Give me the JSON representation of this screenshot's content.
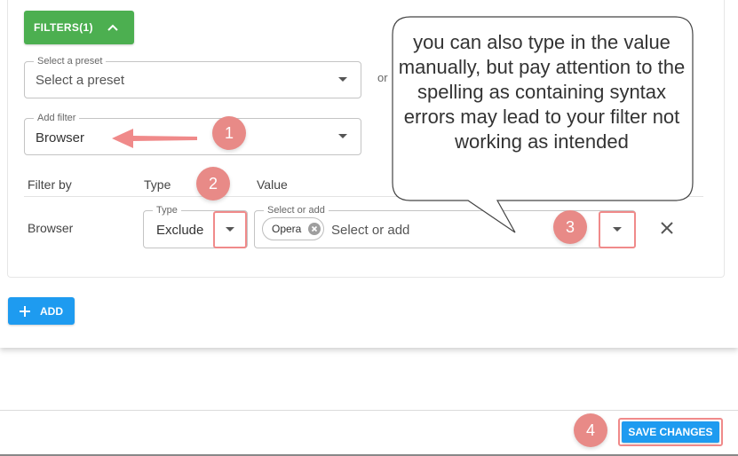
{
  "filters_button": {
    "label": "FILTERS(1)"
  },
  "preset": {
    "legend": "Select a preset",
    "value": "Select a preset"
  },
  "or_label": "or",
  "add_filter": {
    "legend": "Add filter",
    "value": "Browser"
  },
  "table": {
    "headers": [
      "Filter by",
      "Type",
      "Value"
    ],
    "row": {
      "filter_by": "Browser",
      "type_legend": "Type",
      "type_value": "Exclude",
      "value_legend": "Select or add",
      "value_placeholder": "Select or add",
      "chips": [
        "Opera"
      ]
    }
  },
  "add_button": {
    "label": "ADD"
  },
  "save_button": {
    "label": "SAVE CHANGES"
  },
  "callout": {
    "text": "you can also type in the value manually, but pay attention to the spelling as containing syntax errors may lead to your filter not working as intended"
  },
  "badges": [
    "1",
    "2",
    "3",
    "4"
  ],
  "colors": {
    "green": "#4caf50",
    "blue": "#1e9bf0",
    "annotation": "#e88a87"
  },
  "icons": {
    "chevron_up": "chevron-up-icon",
    "dropdown": "caret-down-icon",
    "close": "close-icon",
    "plus": "plus-icon",
    "chip_remove": "cancel-circle-icon"
  }
}
